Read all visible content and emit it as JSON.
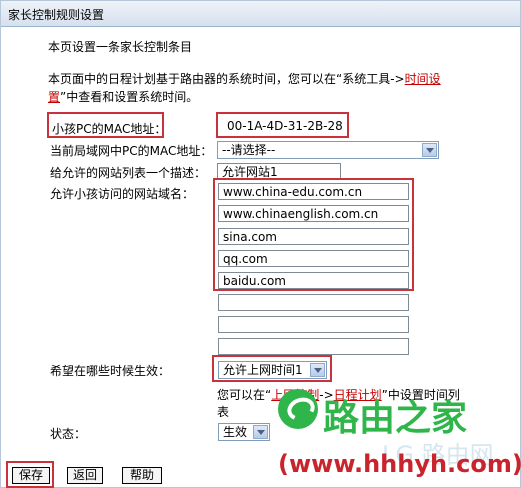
{
  "header": {
    "title": "家长控制规则设置"
  },
  "intro": {
    "heading": "本页设置一条家长控制条目",
    "desc_line1_pre": "本页面中的日程计划基于路由器的系统时间，您可以在“系统工具->",
    "desc_line1_link": "时间设",
    "desc_line2_link": "置",
    "desc_line2_post": "”中查看和设置系统时间。"
  },
  "form": {
    "child_mac_label": "小孩PC的MAC地址：",
    "child_mac_value": "00-1A-4D-31-2B-28",
    "lan_mac_label": "当前局域网中PC的MAC地址：",
    "lan_mac_selected": "--请选择--",
    "desc_label": "给允许的网站列表一个描述：",
    "desc_value": "允许网站1",
    "domains_label": "允许小孩访问的网站域名：",
    "domains": [
      "www.china-edu.com.cn",
      "www.chinaenglish.com.cn",
      "sina.com",
      "qq.com",
      "baidu.com",
      "",
      "",
      ""
    ],
    "schedule_label": "希望在哪些时候生效：",
    "schedule_selected": "允许上网时间1",
    "schedule_note_pre": "您可以在“",
    "schedule_note_link1": "上网控制",
    "schedule_note_sep": "->",
    "schedule_note_link2": "日程计划",
    "schedule_note_post": "”中设置时间列",
    "schedule_note_line2": "表",
    "status_label": "状态：",
    "status_selected": "生效"
  },
  "buttons": {
    "save": "保存",
    "back": "返回",
    "help": "帮助"
  },
  "watermark": {
    "title": "路由之家",
    "url": "(www.hhhyh.com)",
    "faded": "LG 路由网"
  },
  "colors": {
    "highlight": "#c8323b",
    "link": "#c50000",
    "watermark_green": "#2fb54a",
    "watermark_red": "#c9232b"
  }
}
